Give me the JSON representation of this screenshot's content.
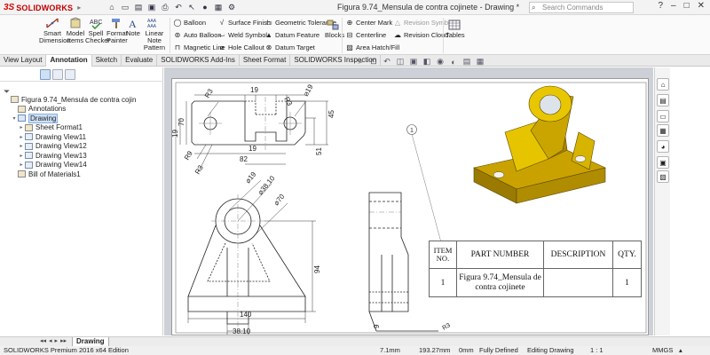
{
  "app": {
    "brand": "SOLIDWORKS",
    "document_title": "Figura 9.74_Mensula de contra cojinete - Drawing *",
    "search_placeholder": "Search Commands"
  },
  "ribbon": {
    "large_buttons": [
      {
        "name": "smart-dimension",
        "label1": "Smart",
        "label2": "Dimension"
      },
      {
        "name": "model-items",
        "label1": "Model",
        "label2": "Items"
      },
      {
        "name": "spell-checker",
        "label1": "Spell",
        "label2": "Checker"
      },
      {
        "name": "format-painter",
        "label1": "Format",
        "label2": "Painter"
      },
      {
        "name": "note",
        "label1": "Note",
        "label2": ""
      },
      {
        "name": "linear-note-pattern",
        "label1": "Linear Note",
        "label2": "Pattern"
      }
    ],
    "small_buttons": {
      "balloon": "Balloon",
      "auto_balloon": "Auto Balloon",
      "magnetic_line": "Magnetic Line",
      "surface_finish": "Surface Finish",
      "weld_symbol": "Weld Symbol",
      "hole_callout": "Hole Callout",
      "geometric_tolerance": "Geometric Tolerance",
      "datum_feature": "Datum Feature",
      "datum_target": "Datum Target",
      "center_mark": "Center Mark",
      "centerline": "Centerline",
      "area_hatch_fill": "Area Hatch/Fill",
      "revision_symbol": "Revision Symbol",
      "revision_cloud": "Revision Cloud"
    },
    "blocks": "Blocks",
    "tables": "Tables"
  },
  "tabs": [
    "View Layout",
    "Annotation",
    "Sketch",
    "Evaluate",
    "SOLIDWORKS Add-Ins",
    "Sheet Format",
    "SOLIDWORKS Inspection"
  ],
  "active_tab": "Annotation",
  "tree": [
    {
      "label": "Figura 9.74_Mensula de contra cojin",
      "level": 0,
      "expand": "",
      "icon": "drawing"
    },
    {
      "label": "Annotations",
      "level": 1,
      "expand": "",
      "icon": "annotations"
    },
    {
      "label": "Drawing",
      "level": 1,
      "expand": "▾",
      "icon": "sheet",
      "selected": true
    },
    {
      "label": "Sheet Format1",
      "level": 2,
      "expand": "▸",
      "icon": "format"
    },
    {
      "label": "Drawing View11",
      "level": 2,
      "expand": "▸",
      "icon": "view"
    },
    {
      "label": "Drawing View12",
      "level": 2,
      "expand": "▸",
      "icon": "view"
    },
    {
      "label": "Drawing View13",
      "level": 2,
      "expand": "▸",
      "icon": "view"
    },
    {
      "label": "Drawing View14",
      "level": 2,
      "expand": "▸",
      "icon": "view"
    },
    {
      "label": "Bill of Materials1",
      "level": 1,
      "expand": "",
      "icon": "bom"
    }
  ],
  "drawing": {
    "dims": {
      "r3_a": "R3",
      "d19_top": "19",
      "r3_b": "R3",
      "phi19_top": "⌀19",
      "dim45": "45",
      "dim70": "70",
      "dim19_side": "19",
      "dim51": "51",
      "r9": "R9",
      "r3_c": "R3",
      "d19_low": "19",
      "dim82": "82",
      "d1": "⌀19",
      "phi38": "⌀38.10",
      "phi70": "⌀70",
      "dim94": "94",
      "dim140": "140",
      "dim38": "38.10",
      "dim9": "9",
      "r3_d": "R3"
    },
    "balloon": "1"
  },
  "bom": {
    "headers": [
      "ITEM NO.",
      "PART NUMBER",
      "DESCRIPTION",
      "QTY."
    ],
    "rows": [
      {
        "item": "1",
        "part": "Figura 9.74_Mensula de contra cojinete",
        "description": "",
        "qty": "1"
      }
    ]
  },
  "sheet_tab": "Drawing",
  "status": {
    "edition": "SOLIDWORKS Premium 2016 x64 Edition",
    "x": "7.1mm",
    "y": "193.27mm",
    "z": "0mm",
    "state": "Fully Defined",
    "mode": "Editing Drawing",
    "scale": "1 : 1",
    "units": "MMGS"
  },
  "colors": {
    "part_gold": "#d4b000",
    "part_dark": "#8a6e00",
    "status_bg": "#f0f0f0"
  }
}
